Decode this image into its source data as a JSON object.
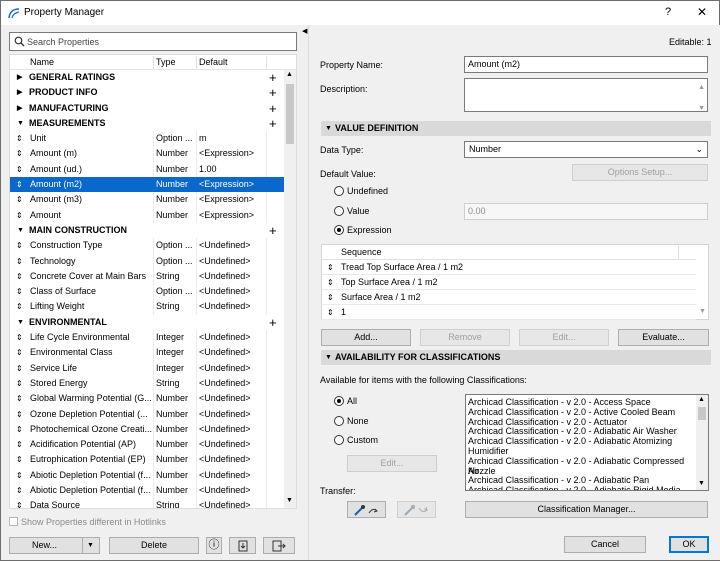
{
  "window": {
    "title": "Property Manager",
    "help": "?",
    "close": "✕"
  },
  "search": {
    "placeholder": "Search Properties",
    "value": ""
  },
  "columns": {
    "name": "Name",
    "type": "Type",
    "default": "Default"
  },
  "rows": [
    {
      "kind": "group",
      "name": "GENERAL RATINGS",
      "expanded": false
    },
    {
      "kind": "group",
      "name": "PRODUCT INFO",
      "expanded": false
    },
    {
      "kind": "group",
      "name": "MANUFACTURING",
      "expanded": false
    },
    {
      "kind": "group",
      "name": "MEASUREMENTS",
      "expanded": true
    },
    {
      "kind": "item",
      "name": "Unit",
      "type": "Option ...",
      "default": "m"
    },
    {
      "kind": "item",
      "name": "Amount (m)",
      "type": "Number",
      "default": "<Expression>"
    },
    {
      "kind": "item",
      "name": "Amount (ud.)",
      "type": "Number",
      "default": "1.00"
    },
    {
      "kind": "item",
      "name": "Amount (m2)",
      "type": "Number",
      "default": "<Expression>",
      "selected": true
    },
    {
      "kind": "item",
      "name": "Amount (m3)",
      "type": "Number",
      "default": "<Expression>"
    },
    {
      "kind": "item",
      "name": "Amount",
      "type": "Number",
      "default": "<Expression>"
    },
    {
      "kind": "group",
      "name": "MAIN CONSTRUCTION",
      "expanded": true
    },
    {
      "kind": "item",
      "name": "Construction Type",
      "type": "Option ...",
      "default": "<Undefined>"
    },
    {
      "kind": "item",
      "name": "Technology",
      "type": "Option ...",
      "default": "<Undefined>"
    },
    {
      "kind": "item",
      "name": "Concrete Cover at Main Bars",
      "type": "String",
      "default": "<Undefined>"
    },
    {
      "kind": "item",
      "name": "Class of Surface",
      "type": "Option ...",
      "default": "<Undefined>"
    },
    {
      "kind": "item",
      "name": "Lifting Weight",
      "type": "String",
      "default": "<Undefined>"
    },
    {
      "kind": "group",
      "name": "ENVIRONMENTAL",
      "expanded": true
    },
    {
      "kind": "item",
      "name": "Life Cycle Environmental",
      "type": "Integer",
      "default": "<Undefined>"
    },
    {
      "kind": "item",
      "name": "Environmental Class",
      "type": "Integer",
      "default": "<Undefined>"
    },
    {
      "kind": "item",
      "name": "Service Life",
      "type": "Integer",
      "default": "<Undefined>"
    },
    {
      "kind": "item",
      "name": "Stored Energy",
      "type": "String",
      "default": "<Undefined>"
    },
    {
      "kind": "item",
      "name": "Global Warming Potential (G...",
      "type": "Number",
      "default": "<Undefined>"
    },
    {
      "kind": "item",
      "name": "Ozone Depletion Potential (...",
      "type": "Number",
      "default": "<Undefined>"
    },
    {
      "kind": "item",
      "name": "Photochemical Ozone Creati...",
      "type": "Number",
      "default": "<Undefined>"
    },
    {
      "kind": "item",
      "name": "Acidification Potential (AP)",
      "type": "Number",
      "default": "<Undefined>"
    },
    {
      "kind": "item",
      "name": "Eutrophication Potential (EP)",
      "type": "Number",
      "default": "<Undefined>"
    },
    {
      "kind": "item",
      "name": "Abiotic Depletion Potential (f...",
      "type": "Number",
      "default": "<Undefined>"
    },
    {
      "kind": "item",
      "name": "Abiotic Depletion Potential (f...",
      "type": "Number",
      "default": "<Undefined>"
    },
    {
      "kind": "item",
      "name": "Data Source",
      "type": "String",
      "default": "<Undefined>"
    }
  ],
  "left_footer": {
    "hotlinks_label": "Show Properties different in Hotlinks",
    "new_label": "New...",
    "new_dropdown": "▼",
    "delete_label": "Delete",
    "info_icon": "ⓘ",
    "import_icon": "⇩",
    "export_icon": "⇨"
  },
  "right": {
    "editable": "Editable: 1",
    "property_name_label": "Property Name:",
    "property_name_value": "Amount (m2)",
    "description_label": "Description:",
    "description_value": "",
    "value_definition": "VALUE DEFINITION",
    "data_type_label": "Data Type:",
    "data_type_value": "Number",
    "default_value_label": "Default Value:",
    "options_setup": "Options Setup...",
    "radio_undefined": "Undefined",
    "radio_value": "Value",
    "value_field": "0.00",
    "radio_expression": "Expression",
    "sequence_header": "Sequence",
    "sequence": [
      "Tread Top Surface Area / 1 m2",
      "Top Surface Area / 1 m2",
      "Surface Area / 1 m2",
      "1"
    ],
    "add": "Add...",
    "remove": "Remove",
    "edit": "Edit...",
    "evaluate": "Evaluate...",
    "availability": "AVAILABILITY FOR CLASSIFICATIONS",
    "available_label": "Available for items with the following Classifications:",
    "radio_all": "All",
    "radio_none": "None",
    "radio_custom": "Custom",
    "edit2": "Edit...",
    "classifications": [
      "Archicad Classification - v 2.0 - Access Space",
      "Archicad Classification - v 2.0 - Active Cooled Beam",
      "Archicad Classification - v 2.0 - Actuator",
      "Archicad Classification - v 2.0 - Adiabatic Air Washer",
      "Archicad Classification - v 2.0 - Adiabatic Atomizing",
      "Humidifier",
      "Archicad Classification - v 2.0 - Adiabatic Compressed Air",
      "Nozzle",
      "Archicad Classification - v 2.0 - Adiabatic Pan",
      "Archicad Classification - v 2.0 - Adiabatic Rigid Media"
    ],
    "transfer_label": "Transfer:",
    "classification_manager": "Classification Manager...",
    "cancel": "Cancel",
    "ok": "OK"
  }
}
